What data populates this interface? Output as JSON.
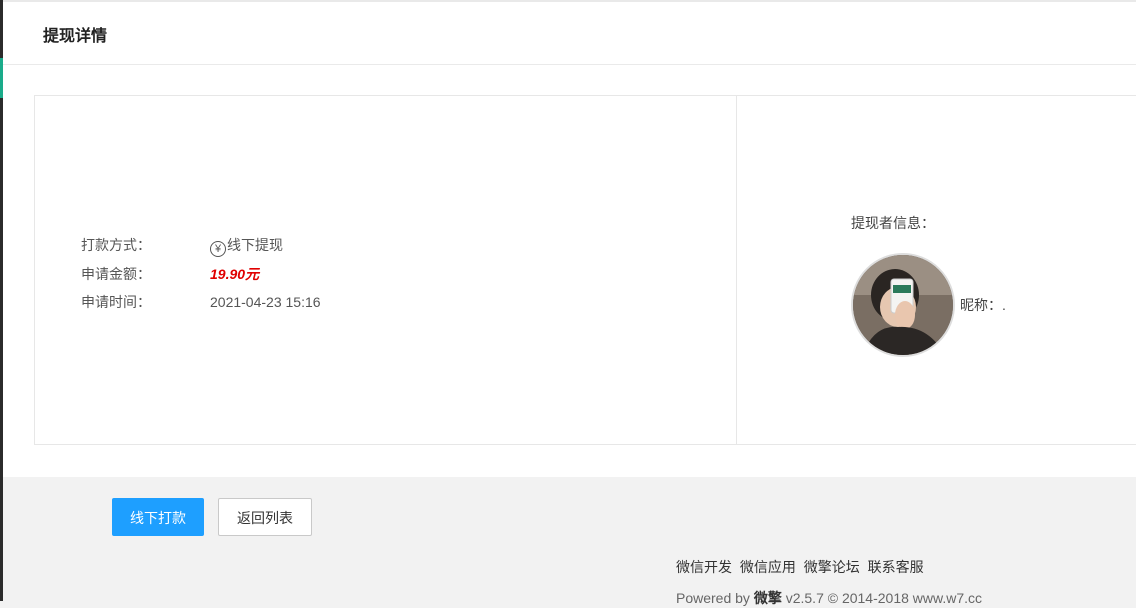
{
  "page": {
    "title": "提现详情"
  },
  "withdrawal": {
    "method_label": "打款方式：",
    "method_value": "线下提现",
    "method_icon": "yuan-circle-icon",
    "amount_label": "申请金额：",
    "amount_value": "19.90元",
    "time_label": "申请时间：",
    "time_value": "2021-04-23 15:16"
  },
  "user": {
    "heading": "提现者信息：",
    "nickname_label": "昵称：.",
    "avatar_icon": "user-avatar"
  },
  "actions": {
    "offline_pay": "线下打款",
    "back_to_list": "返回列表"
  },
  "footer": {
    "links": [
      "微信开发",
      "微信应用",
      "微擎论坛",
      "联系客服"
    ],
    "powered_prefix": "Powered by",
    "brand": "微擎",
    "version": "v2.5.7 © 2014-2018 www.w7.cc"
  },
  "colors": {
    "primary": "#1e9fff",
    "amount": "#e00000",
    "sidebar_accent": "#1aab8a"
  }
}
